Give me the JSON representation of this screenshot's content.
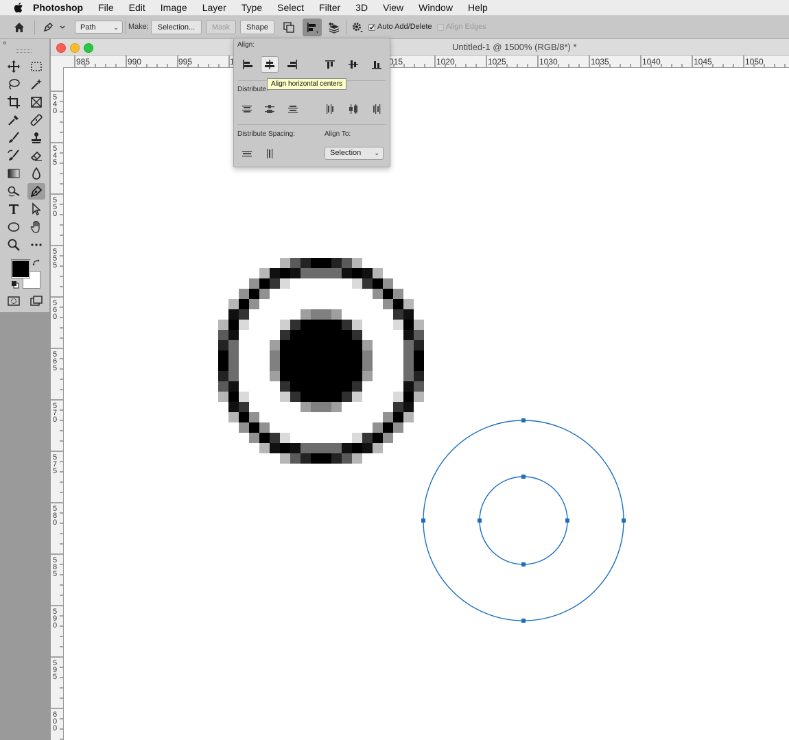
{
  "menubar": {
    "app_name": "Photoshop",
    "items": [
      "File",
      "Edit",
      "Image",
      "Layer",
      "Type",
      "Select",
      "Filter",
      "3D",
      "View",
      "Window",
      "Help"
    ]
  },
  "options_bar": {
    "path_mode": "Path",
    "make_label": "Make:",
    "selection_button": "Selection...",
    "mask_button": "Mask",
    "shape_button": "Shape",
    "auto_add_delete_label": "Auto Add/Delete",
    "auto_add_delete_checked": true,
    "align_edges_label": "Align Edges",
    "align_edges_checked": false
  },
  "document": {
    "title": "Untitled-1 @ 1500% (RGB/8*) *",
    "ruler_h": [
      "985",
      "990",
      "995",
      "1",
      "015",
      "1020",
      "1025",
      "1030",
      "1035",
      "1040",
      "1045",
      "1050"
    ],
    "ruler_v": [
      "540",
      "545",
      "550",
      "555",
      "560",
      "565",
      "570",
      "575",
      "580",
      "585",
      "590",
      "595",
      "600"
    ]
  },
  "align_panel": {
    "align_label": "Align:",
    "distribute_label": "Distribute:",
    "distribute_spacing_label": "Distribute Spacing:",
    "align_to_label": "Align To:",
    "align_to_value": "Selection",
    "tooltip": "Align horizontal centers"
  },
  "tools": {
    "foreground_color": "#000000",
    "background_color": "#ffffff"
  },
  "colors": {
    "path_blue": "#1a6fc4",
    "panel_gray": "#c8c8c8",
    "tooltip_yellow": "#fdfdc6"
  }
}
